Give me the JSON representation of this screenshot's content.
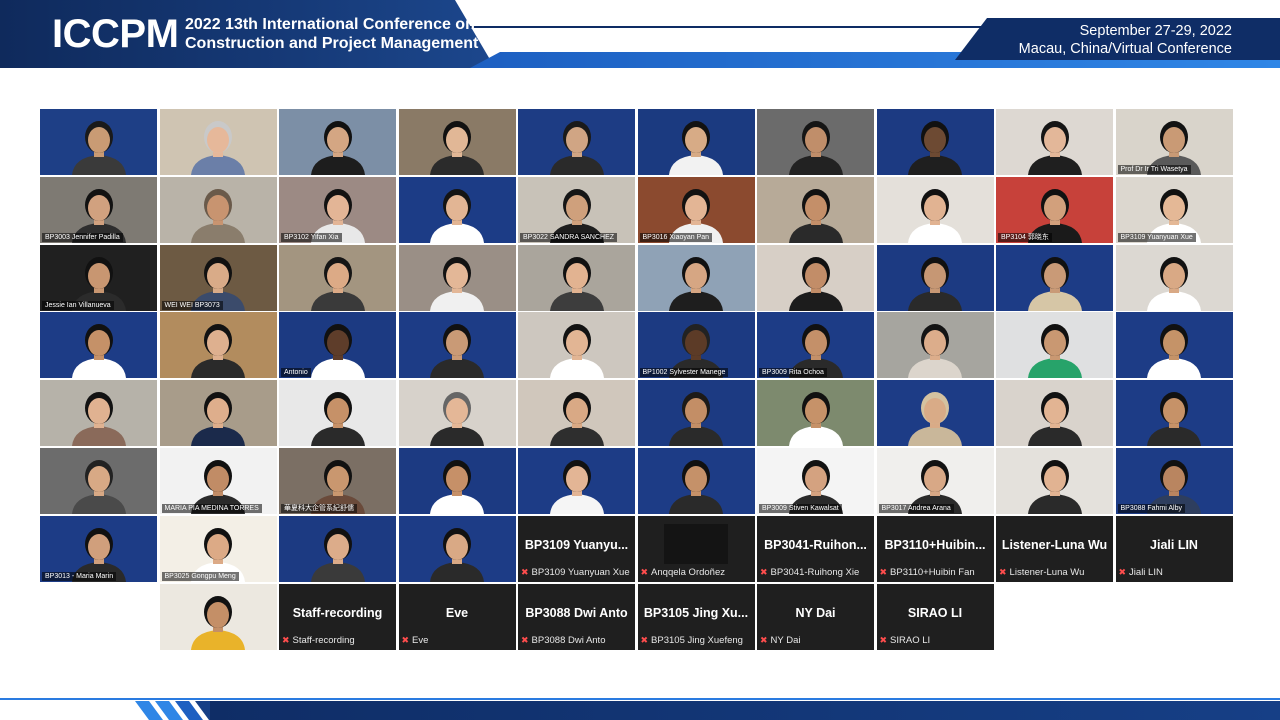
{
  "header": {
    "logo": "ICCPM",
    "title_line1": "2022 13th International Conference on",
    "title_line2": "Construction and Project Management",
    "dates": "September 27-29, 2022",
    "location": "Macau, China/Virtual Conference"
  },
  "tiles": [
    {
      "label": "",
      "bg": "#1e3f86",
      "skin": "#c99b74",
      "shirt": "#3a3a3a",
      "hair": "#1a1a1a"
    },
    {
      "label": "",
      "bg": "#cfc4b2",
      "skin": "#e6b89a",
      "shirt": "#6b7fa8",
      "hair": "#c9c9c9"
    },
    {
      "label": "",
      "bg": "#7c8fa6",
      "skin": "#d4a683",
      "shirt": "#1d1d1d",
      "hair": "#111111"
    },
    {
      "label": "",
      "bg": "#8a7a66",
      "skin": "#e1b796",
      "shirt": "#2b2b2b",
      "hair": "#111111"
    },
    {
      "label": "",
      "bg": "#1d3c84",
      "skin": "#d0a584",
      "shirt": "#2a2a2a",
      "hair": "#1a1a1a"
    },
    {
      "label": "",
      "bg": "#1b3a80",
      "skin": "#d7ab86",
      "shirt": "#f2f2f2",
      "hair": "#121212"
    },
    {
      "label": "",
      "bg": "#6b6b6b",
      "skin": "#c08e6a",
      "shirt": "#222222",
      "hair": "#151515"
    },
    {
      "label": "",
      "bg": "#1c3a82",
      "skin": "#6d4a33",
      "shirt": "#1f1f1f",
      "hair": "#111111"
    },
    {
      "label": "",
      "bg": "#ddd8d2",
      "skin": "#e3b799",
      "shirt": "#1f1f1f",
      "hair": "#151515"
    },
    {
      "label": "Prof Dr Ir Tri Wasetya",
      "bg": "#d9d4cb",
      "skin": "#c99a75",
      "shirt": "#5a5a5a",
      "hair": "#121212"
    },
    {
      "label": "BP3003 Jennifer Padilla",
      "bg": "#7e7a73",
      "skin": "#d1a17f",
      "shirt": "#2e2e2e",
      "hair": "#121212"
    },
    {
      "label": "",
      "bg": "#b9b3a8",
      "skin": "#c89470",
      "shirt": "#8a7d6c",
      "hair": "#6a5a4a"
    },
    {
      "label": "BP3102 Yifan Xia",
      "bg": "#9c8a84",
      "skin": "#e3b596",
      "shirt": "#e8e8e8",
      "hair": "#121212"
    },
    {
      "label": "",
      "bg": "#1c3c86",
      "skin": "#e2b594",
      "shirt": "#ffffff",
      "hair": "#141414"
    },
    {
      "label": "BP3022 SANDRA SANCHEZ",
      "bg": "#c8c2b8",
      "skin": "#cfa07c",
      "shirt": "#1e1e1e",
      "hair": "#161616"
    },
    {
      "label": "BP3016 Xiaoyan Pan",
      "bg": "#8b4a2f",
      "skin": "#e3b595",
      "shirt": "#f0f0f0",
      "hair": "#121212"
    },
    {
      "label": "",
      "bg": "#b7aa98",
      "skin": "#c48f69",
      "shirt": "#2a2a2a",
      "hair": "#121212"
    },
    {
      "label": "",
      "bg": "#e4e0da",
      "skin": "#e1b392",
      "shirt": "#ffffff",
      "hair": "#111111"
    },
    {
      "label": "BP3104 郭晓东",
      "bg": "#c7413a",
      "skin": "#d2a07c",
      "shirt": "#1a1a1a",
      "hair": "#111111"
    },
    {
      "label": "BP3109 Yuanyuan Xue",
      "bg": "#dcd7cf",
      "skin": "#e4b896",
      "shirt": "#ffffff",
      "hair": "#111111"
    },
    {
      "label": "Jessie Ian Villanueva",
      "bg": "#202020",
      "skin": "#c89671",
      "shirt": "#2b2b2b",
      "hair": "#111111"
    },
    {
      "label": "WEI WEI BP3073",
      "bg": "#6d5a43",
      "skin": "#d9ab88",
      "shirt": "#3b4b6b",
      "hair": "#111111"
    },
    {
      "label": "",
      "bg": "#a39580",
      "skin": "#dcaa86",
      "shirt": "#3a3a3a",
      "hair": "#151515"
    },
    {
      "label": "",
      "bg": "#9a8f86",
      "skin": "#e3b797",
      "shirt": "#f0f0f0",
      "hair": "#121212"
    },
    {
      "label": "",
      "bg": "#aaa59c",
      "skin": "#e2b391",
      "shirt": "#3d3d3d",
      "hair": "#111111"
    },
    {
      "label": "",
      "bg": "#8fa2b6",
      "skin": "#d6a683",
      "shirt": "#1e1e1e",
      "hair": "#111111"
    },
    {
      "label": "",
      "bg": "#d7cfc6",
      "skin": "#c28d68",
      "shirt": "#1c1c1c",
      "hair": "#111111"
    },
    {
      "label": "",
      "bg": "#1c3a82",
      "skin": "#c69774",
      "shirt": "#2a2a2a",
      "hair": "#111111"
    },
    {
      "label": "",
      "bg": "#1d3c86",
      "skin": "#c99a77",
      "shirt": "#d6c6a6",
      "hair": "#111111"
    },
    {
      "label": "",
      "bg": "#dcd8d2",
      "skin": "#d9a985",
      "shirt": "#ffffff",
      "hair": "#121212"
    },
    {
      "label": "",
      "bg": "#1d3c86",
      "skin": "#c59168",
      "shirt": "#ffffff",
      "hair": "#111111"
    },
    {
      "label": "",
      "bg": "#b28c5e",
      "skin": "#deb08f",
      "shirt": "#2a2a2a",
      "hair": "#121212"
    },
    {
      "label": "Antonio",
      "bg": "#1c3a82",
      "skin": "#5e3d2a",
      "shirt": "#ffffff",
      "hair": "#111111"
    },
    {
      "label": "",
      "bg": "#1d3c86",
      "skin": "#c99a76",
      "shirt": "#2a2a2a",
      "hair": "#111111"
    },
    {
      "label": "",
      "bg": "#cdc7bf",
      "skin": "#e2b594",
      "shirt": "#ffffff",
      "hair": "#121212"
    },
    {
      "label": "BP1002 Sylvester Manege",
      "bg": "#1c3a82",
      "skin": "#5c3b27",
      "shirt": "#2a2a2a",
      "hair": "#222222"
    },
    {
      "label": "BP3009 Rita Ochoa",
      "bg": "#1d3c86",
      "skin": "#c49069",
      "shirt": "#2a2a2a",
      "hair": "#111111"
    },
    {
      "label": "",
      "bg": "#a6a59f",
      "skin": "#dcad8b",
      "shirt": "#dcd5cc",
      "hair": "#141414"
    },
    {
      "label": "",
      "bg": "#dfe0e1",
      "skin": "#c99872",
      "shirt": "#27a36a",
      "hair": "#111111"
    },
    {
      "label": "",
      "bg": "#1d3c86",
      "skin": "#c59368",
      "shirt": "#ffffff",
      "hair": "#111111"
    },
    {
      "label": "",
      "bg": "#b6b2a9",
      "skin": "#e0b291",
      "shirt": "#8a6a5a",
      "hair": "#121212"
    },
    {
      "label": "",
      "bg": "#a89c8a",
      "skin": "#deae8c",
      "shirt": "#1b2a4b",
      "hair": "#111111"
    },
    {
      "label": "",
      "bg": "#e8e8e8",
      "skin": "#c69168",
      "shirt": "#2a2a2a",
      "hair": "#111111"
    },
    {
      "label": "",
      "bg": "#d7d2cb",
      "skin": "#e4b797",
      "shirt": "#2a2a2a",
      "hair": "#666666"
    },
    {
      "label": "",
      "bg": "#d0c7bc",
      "skin": "#d9a985",
      "shirt": "#2e2e2e",
      "hair": "#111111"
    },
    {
      "label": "",
      "bg": "#1c3a82",
      "skin": "#c38e66",
      "shirt": "#2a2a2a",
      "hair": "#1d1a17"
    },
    {
      "label": "",
      "bg": "#7d8a6e",
      "skin": "#c69269",
      "shirt": "#ffffff",
      "hair": "#111111"
    },
    {
      "label": "",
      "bg": "#1d3c86",
      "skin": "#d9ab87",
      "shirt": "#c9b79a",
      "hair": "#d4c2a0"
    },
    {
      "label": "",
      "bg": "#d9d3cc",
      "skin": "#e2b493",
      "shirt": "#2a2a2a",
      "hair": "#121212"
    },
    {
      "label": "",
      "bg": "#1d3c86",
      "skin": "#c69268",
      "shirt": "#2a2a2a",
      "hair": "#111111"
    },
    {
      "label": "",
      "bg": "#6c6c6c",
      "skin": "#d8a985",
      "shirt": "#4a4a4a",
      "hair": "#222222"
    },
    {
      "label": "MARIA PIA MEDINA TORRES",
      "bg": "#f2f2f2",
      "skin": "#c18c66",
      "shirt": "#2a2a2a",
      "hair": "#111111"
    },
    {
      "label": "華夏科大企管系紀舒儒",
      "bg": "#7b6f64",
      "skin": "#c9976f",
      "shirt": "#6a4a3a",
      "hair": "#111111"
    },
    {
      "label": "",
      "bg": "#1c3a82",
      "skin": "#c69068",
      "shirt": "#ffffff",
      "hair": "#111111"
    },
    {
      "label": "",
      "bg": "#1d3c86",
      "skin": "#e3b595",
      "shirt": "#f5f5f5",
      "hair": "#121212"
    },
    {
      "label": "",
      "bg": "#1d3c86",
      "skin": "#c59169",
      "shirt": "#2a2a2a",
      "hair": "#111111"
    },
    {
      "label": "BP3009 Stiven Kawalsat",
      "bg": "#f4f4f4",
      "skin": "#d4a280",
      "shirt": "#2a2a2a",
      "hair": "#121212"
    },
    {
      "label": "BP3017 Andrea Arana",
      "bg": "#f0efed",
      "skin": "#d8a886",
      "shirt": "#2a2a2a",
      "hair": "#121212"
    },
    {
      "label": "",
      "bg": "#e4e1dc",
      "skin": "#e1b392",
      "shirt": "#2a2a2a",
      "hair": "#111111"
    },
    {
      "label": "BP3088 Fahmi Alby",
      "bg": "#1d3c86",
      "skin": "#b98560",
      "shirt": "#2e3e5e",
      "hair": "#111111"
    },
    {
      "label": "BP3013 - Maria Marin",
      "bg": "#1d3c86",
      "skin": "#d09f7c",
      "shirt": "#2a2a2a",
      "hair": "#111111"
    },
    {
      "label": "BP3025 Gongpu Meng",
      "bg": "#f3efe6",
      "skin": "#dcaa86",
      "shirt": "#ffffff",
      "hair": "#111111"
    },
    {
      "label": "",
      "bg": "#1c3a82",
      "skin": "#dcac8a",
      "shirt": "#3a3a3a",
      "hair": "#111111"
    },
    {
      "label": "",
      "bg": "#1d3c86",
      "skin": "#d9a985",
      "shirt": "#2a2a2a",
      "hair": "#111111"
    },
    {
      "label": "",
      "bg": "#ece8e0",
      "skin": "#c48f67",
      "shirt": "#e9b32a",
      "hair": "#111111"
    }
  ],
  "name_tiles": [
    {
      "title": "BP3109 Yuanyu...",
      "name": "BP3109 Yuanyuan Xue"
    },
    {
      "title": "",
      "name": "Anqqela Ordoñez"
    },
    {
      "title": "BP3041-Ruihon...",
      "name": "BP3041-Ruihong Xie"
    },
    {
      "title": "BP3110+Huibin...",
      "name": "BP3110+Huibin Fan"
    },
    {
      "title": "Listener-Luna Wu",
      "name": "Listener-Luna Wu"
    },
    {
      "title": "Jiali LIN",
      "name": "Jiali LIN"
    },
    {
      "title": "Staff-recording",
      "name": "Staff-recording"
    },
    {
      "title": "Eve",
      "name": "Eve"
    },
    {
      "title": "BP3088 Dwi Anto",
      "name": "BP3088 Dwi Anto"
    },
    {
      "title": "BP3105 Jing Xu...",
      "name": "BP3105 Jing Xuefeng"
    },
    {
      "title": "NY Dai",
      "name": "NY Dai"
    },
    {
      "title": "SIRAO LI",
      "name": "SIRAO LI"
    }
  ]
}
